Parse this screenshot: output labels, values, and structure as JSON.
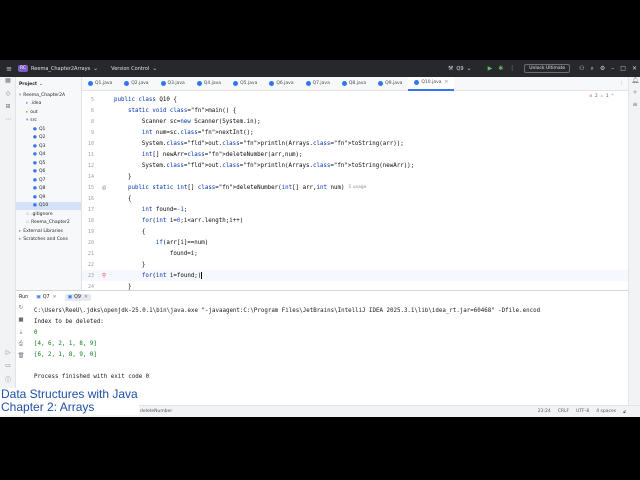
{
  "titlebar": {
    "project_badge": "RC",
    "project_name": "Reema_Chapter2Arrays",
    "vcs": "Version Control",
    "run_config": "Q9",
    "unlock": "Unlock Ultimate"
  },
  "project_panel": {
    "title": "Project",
    "items": [
      {
        "label": "Reema_Chapter2A",
        "type": "root"
      },
      {
        "label": ".idea",
        "type": "folder"
      },
      {
        "label": "out",
        "type": "folder-out"
      },
      {
        "label": "src",
        "type": "folder-src"
      },
      {
        "label": "Q1",
        "type": "class"
      },
      {
        "label": "Q2",
        "type": "class"
      },
      {
        "label": "Q3",
        "type": "class"
      },
      {
        "label": "Q4",
        "type": "class"
      },
      {
        "label": "Q5",
        "type": "class"
      },
      {
        "label": "Q6",
        "type": "class"
      },
      {
        "label": "Q7",
        "type": "class"
      },
      {
        "label": "Q8",
        "type": "class"
      },
      {
        "label": "Q9",
        "type": "class"
      },
      {
        "label": "Q10",
        "type": "class",
        "selected": true
      },
      {
        "label": ".gitignore",
        "type": "file"
      },
      {
        "label": "Reema_Chapter2",
        "type": "file"
      },
      {
        "label": "External Libraries",
        "type": "lib"
      },
      {
        "label": "Scratches and Cons",
        "type": "lib"
      }
    ]
  },
  "tabs": [
    "Q1.java",
    "Q2.java",
    "Q3.java",
    "Q4.java",
    "Q5.java",
    "Q6.java",
    "Q7.java",
    "Q8.java",
    "Q9.java",
    "Q10.java"
  ],
  "active_tab": "Q10.java",
  "editor_warnings": {
    "errors": "2",
    "warnings": "1"
  },
  "code_lines": [
    {
      "n": "5",
      "gutter": "",
      "html_key": "l5"
    },
    {
      "n": "6",
      "gutter": "",
      "html_key": "l6"
    },
    {
      "n": "8",
      "gutter": "",
      "html_key": "l8"
    },
    {
      "n": "9",
      "gutter": "",
      "html_key": "l9"
    },
    {
      "n": "10",
      "gutter": "",
      "html_key": "l10"
    },
    {
      "n": "11",
      "gutter": "",
      "html_key": "l11"
    },
    {
      "n": "12",
      "gutter": "",
      "html_key": "l12"
    },
    {
      "n": "14",
      "gutter": "",
      "html_key": "l14"
    },
    {
      "n": "15",
      "gutter": "@",
      "html_key": "l15"
    },
    {
      "n": "16",
      "gutter": "",
      "html_key": "l16"
    },
    {
      "n": "17",
      "gutter": "",
      "html_key": "l17"
    },
    {
      "n": "18",
      "gutter": "",
      "html_key": "l18"
    },
    {
      "n": "19",
      "gutter": "",
      "html_key": "l19"
    },
    {
      "n": "20",
      "gutter": "",
      "html_key": "l20"
    },
    {
      "n": "21",
      "gutter": "",
      "html_key": "l21"
    },
    {
      "n": "22",
      "gutter": "",
      "html_key": "l22"
    },
    {
      "n": "23",
      "gutter": "bulb",
      "html_key": "l23"
    },
    {
      "n": "24",
      "gutter": "",
      "html_key": "l24"
    }
  ],
  "code": {
    "l5": "public class Q10 {",
    "l6": "    static void main() {",
    "l8": "        Scanner sc=new Scanner(System.in);",
    "l9": "        int num=sc.nextInt();",
    "l10": "        System.out.println(Arrays.toString(arr));",
    "l11": "        int[] newArr=deleteNumber(arr,num);",
    "l12": "        System.out.println(Arrays.toString(newArr));",
    "l14": "    }",
    "l15": "    public static int[] deleteNumber(int[] arr,int num)",
    "l15_hint": "1 usage",
    "l16": "    {",
    "l17": "        int found=-1;",
    "l18": "        for(int i=0;i<arr.length;i++)",
    "l19": "        {",
    "l20": "            if(arr[i]==num)",
    "l21": "                found=i;",
    "l22": "        }",
    "l23": "        for(int i=found;)",
    "l24": "    }"
  },
  "run_panel": {
    "title": "Run",
    "tabs": [
      {
        "label": "Q7"
      },
      {
        "label": "Q9",
        "active": true
      }
    ],
    "console": [
      "C:\\Users\\ReeU\\.jdks\\openjdk-25.0.1\\bin\\java.exe \"-javaagent:C:\\Program Files\\JetBrains\\IntelliJ IDEA 2025.3.1\\lib\\idea_rt.jar=60468\" -Dfile.encod",
      "Index to be deleted:",
      "0",
      "[4, 6, 2, 1, 8, 9]",
      "[6, 2, 1, 8, 9, 0]",
      "",
      "Process finished with exit code 0"
    ]
  },
  "status": {
    "crumb": "deleteNumber",
    "position": "23:24",
    "line_sep": "CRLF",
    "encoding": "UTF-8",
    "indent": "4 spaces"
  },
  "caption": {
    "line1": "Data Structures with Java",
    "line2": "Chapter 2: Arrays"
  }
}
